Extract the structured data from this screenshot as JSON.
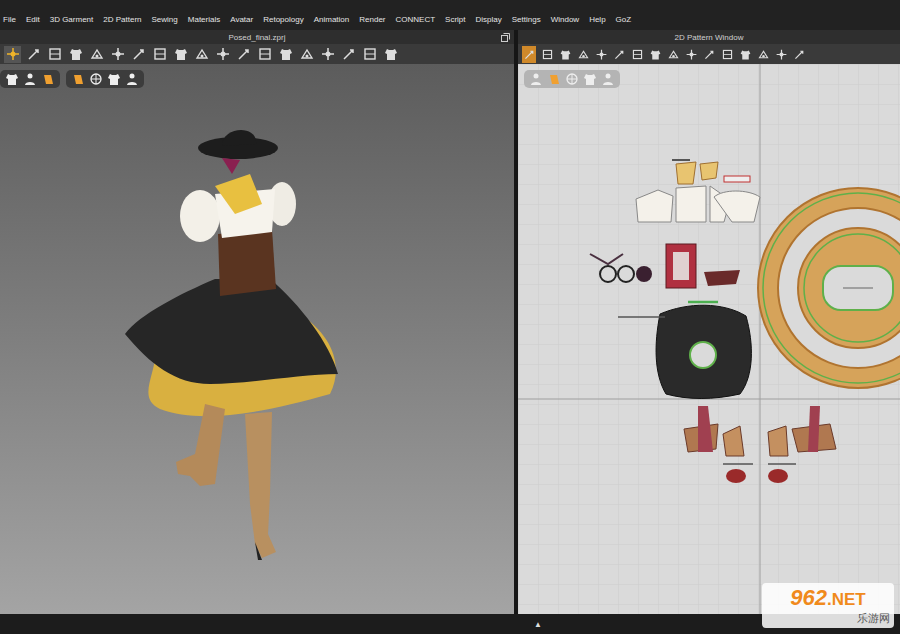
{
  "menu": [
    "File",
    "Edit",
    "3D Garment",
    "2D Pattern",
    "Sewing",
    "Materials",
    "Avatar",
    "Retopology",
    "Animation",
    "Render",
    "CONNECT",
    "Script",
    "Display",
    "Settings",
    "Window",
    "Help",
    "GoZ"
  ],
  "viewport3d": {
    "title": "Posed_final.zprj",
    "tools": [
      {
        "selected": true
      },
      {
        "selected": false
      },
      {
        "selected": false
      },
      {
        "selected": false
      },
      {
        "selected": false
      },
      {
        "selected": false
      },
      {
        "selected": false
      },
      {
        "selected": false
      },
      {
        "selected": false
      },
      {
        "selected": false
      },
      {
        "selected": false
      },
      {
        "selected": false
      },
      {
        "selected": false
      },
      {
        "selected": false
      },
      {
        "selected": false
      },
      {
        "selected": false
      },
      {
        "selected": false
      },
      {
        "selected": false
      },
      {
        "selected": false
      }
    ],
    "quick_tools": [
      [
        {
          "selected": false
        },
        {
          "selected": false
        },
        {
          "selected": false
        }
      ],
      [
        {
          "selected": false
        },
        {
          "selected": false
        },
        {
          "selected": false
        },
        {
          "selected": false
        }
      ]
    ]
  },
  "pattern2d": {
    "title": "2D Pattern Window",
    "tools": [
      {
        "selected": true
      },
      {
        "selected": false
      },
      {
        "selected": false
      },
      {
        "selected": false
      },
      {
        "selected": false
      },
      {
        "selected": false
      },
      {
        "selected": false
      },
      {
        "selected": false
      },
      {
        "selected": false
      },
      {
        "selected": false
      },
      {
        "selected": false
      },
      {
        "selected": false
      },
      {
        "selected": false
      },
      {
        "selected": false
      },
      {
        "selected": false
      },
      {
        "selected": false
      }
    ],
    "quick_tools": [
      [
        {
          "selected": false
        },
        {
          "selected": false
        },
        {
          "selected": false
        },
        {
          "selected": false
        },
        {
          "selected": false
        }
      ]
    ]
  },
  "status_bar": {
    "toggle": "▲"
  },
  "watermark": {
    "number": "962",
    "suffix": ".NET",
    "name": "乐游网"
  }
}
